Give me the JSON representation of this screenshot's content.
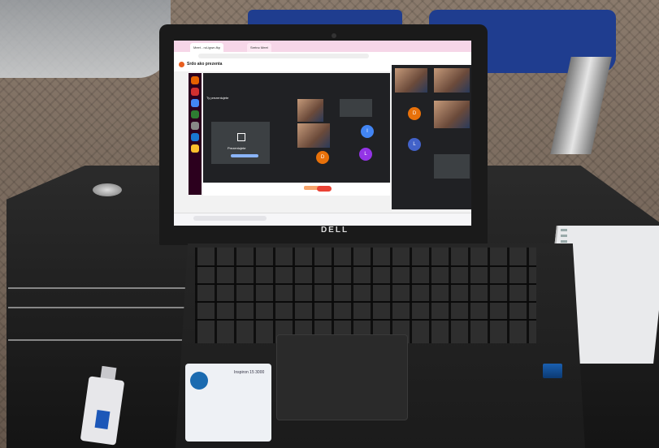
{
  "laptop": {
    "brand_logo": "DELL",
    "sticker_title": "Inspiron 15 3000"
  },
  "screen": {
    "browser_tabs": [
      "Meet - rul-igwn-fkp",
      "Sretno Meet"
    ],
    "header_title": "Srdo ako prezenta",
    "you_present_label": "Ty prezentujete",
    "present_tile_label": "Prezentujete",
    "avatars": [
      {
        "letter": "I",
        "color": "#4285f4"
      },
      {
        "letter": "D",
        "color": "#e8710a"
      },
      {
        "letter": "L",
        "color": "#9334e6"
      },
      {
        "letter": "D",
        "color": "#e8710a"
      },
      {
        "letter": "L",
        "color": "#4262c9"
      }
    ],
    "colors": {
      "browser_tab_strip": "#f6d6e8",
      "meet_background": "#202124",
      "end_call_red": "#ea4335",
      "dock_purple": "#2c001e"
    }
  },
  "scene": {
    "colors": {
      "chair_blue": "#1f3d8f",
      "table_black": "#141414",
      "usb_blue": "#1c57b8"
    }
  }
}
